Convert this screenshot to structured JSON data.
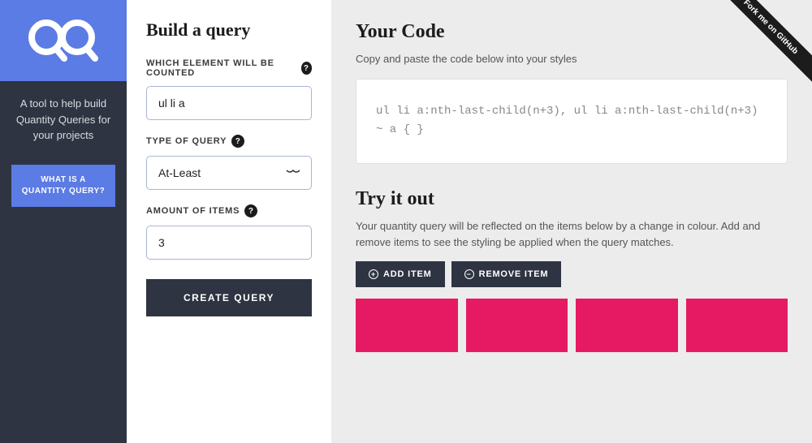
{
  "sidebar": {
    "tagline": "A tool to help build Quantity Queries for your projects",
    "button_label": "WHAT IS A QUANTITY QUERY?"
  },
  "form": {
    "title": "Build a query",
    "fields": {
      "element": {
        "label": "WHICH ELEMENT WILL BE COUNTED",
        "value": "ul li a"
      },
      "type": {
        "label": "TYPE OF QUERY",
        "value": "At-Least"
      },
      "amount": {
        "label": "AMOUNT OF ITEMS",
        "value": "3"
      }
    },
    "submit_label": "CREATE QUERY"
  },
  "code_section": {
    "title": "Your Code",
    "desc": "Copy and paste the code below into your styles",
    "code": "ul li a:nth-last-child(n+3), ul li a:nth-last-child(n+3) ~ a { }"
  },
  "try_section": {
    "title": "Try it out",
    "desc": "Your quantity query will be reflected on the items below by a change in colour. Add and remove items to see the styling be applied when the query matches.",
    "add_label": "ADD ITEM",
    "remove_label": "REMOVE ITEM",
    "item_count": 4,
    "item_color": "#e61a63"
  },
  "github_ribbon": "Fork me on GitHub"
}
